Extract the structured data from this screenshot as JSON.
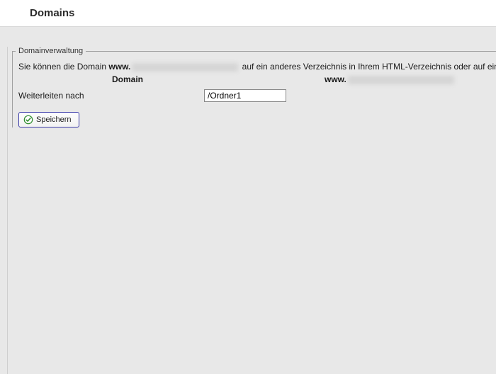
{
  "header": {
    "title": "Domains"
  },
  "groupbox": {
    "legend": "Domainverwaltung",
    "description_prefix": "Sie können die Domain ",
    "description_www": "www.",
    "description_suffix": " auf ein anderes Verzeichnis in Ihrem HTML-Verzeichnis oder auf eine andere U",
    "columns": {
      "domain_label": "Domain",
      "www_label": "www."
    },
    "form": {
      "redirect_label": "Weiterleiten nach",
      "redirect_value": "/Ordner1"
    },
    "buttons": {
      "save_label": "Speichern"
    }
  }
}
